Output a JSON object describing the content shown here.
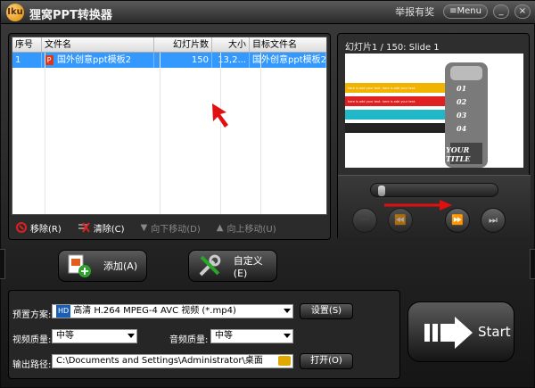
{
  "titlebar": {
    "logo_text": "Iku",
    "title": "狸窝PPT转换器",
    "link": "举报有奖",
    "menu": "Menu",
    "minimize": "_",
    "close": "×"
  },
  "list": {
    "columns": [
      "序号",
      "文件名",
      "幻灯片数",
      "大小",
      "目标文件名"
    ],
    "rows": [
      {
        "index": "1",
        "filename": "国外创意ppt模板2",
        "slides": "150",
        "size": "13,2...",
        "target": "国外创意ppt模板2"
      }
    ],
    "toolbar": {
      "remove": "移除(R)",
      "clear": "清除(C)",
      "move_down": "向下移动(D)",
      "move_up": "向上移动(U)"
    }
  },
  "preview": {
    "title": "幻灯片1 / 150: Slide 1",
    "slide": {
      "numbers": [
        "01",
        "02",
        "03",
        "04"
      ],
      "caption_line1": "YOUR",
      "caption_line2": "TITLE",
      "text_rows": [
        "here is add your text. here is add your text.",
        "here is add your text. here is add your text."
      ]
    },
    "controls": [
      "prev",
      "rewind",
      "forward",
      "next"
    ],
    "progress": 0.02
  },
  "actions": {
    "add": "添加(A)",
    "custom": "自定义(E)"
  },
  "form": {
    "preset_label": "预置方案:",
    "preset_value": "高清 H.264 MPEG-4 AVC 视频 (*.mp4)",
    "preset_badge": "HD",
    "settings_button": "设置(S)",
    "video_quality_label": "视频质量:",
    "video_quality_value": "中等",
    "audio_quality_label": "音频质量:",
    "audio_quality_value": "中等",
    "output_label": "输出路径:",
    "output_value": "C:\\Documents and Settings\\Administrator\\桌面",
    "open_button": "打开(O)"
  },
  "start": {
    "label": "Start"
  },
  "colors": {
    "selection": "#3399ff",
    "accent_red": "#e02020"
  }
}
